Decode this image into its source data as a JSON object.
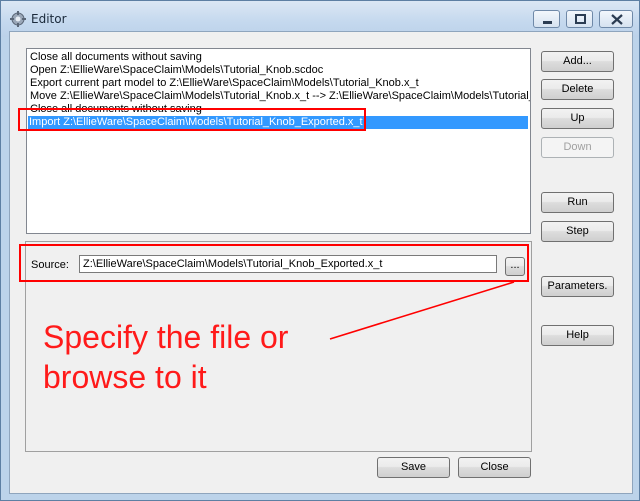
{
  "window": {
    "title": "Editor"
  },
  "colors": {
    "annotation": "#ff0000",
    "selection": "#3399ff"
  },
  "commands": [
    "Close all documents without saving",
    "Open Z:\\EllieWare\\SpaceClaim\\Models\\Tutorial_Knob.scdoc",
    "Export current part model to Z:\\EllieWare\\SpaceClaim\\Models\\Tutorial_Knob.x_t",
    "Move Z:\\EllieWare\\SpaceClaim\\Models\\Tutorial_Knob.x_t --> Z:\\EllieWare\\SpaceClaim\\Models\\Tutorial_",
    "Close all documents without saving",
    "Import Z:\\EllieWare\\SpaceClaim\\Models\\Tutorial_Knob_Exported.x_t"
  ],
  "selected_index": 5,
  "buttons": {
    "add": "Add...",
    "delete": "Delete",
    "up": "Up",
    "down": "Down",
    "run": "Run",
    "step": "Step",
    "parameters": "Parameters.",
    "help": "Help",
    "save": "Save",
    "close": "Close",
    "browse": "..."
  },
  "source": {
    "label": "Source:",
    "value": "Z:\\EllieWare\\SpaceClaim\\Models\\Tutorial_Knob_Exported.x_t"
  },
  "annotation": {
    "line1": "Specify the file or",
    "line2": "browse to it"
  }
}
